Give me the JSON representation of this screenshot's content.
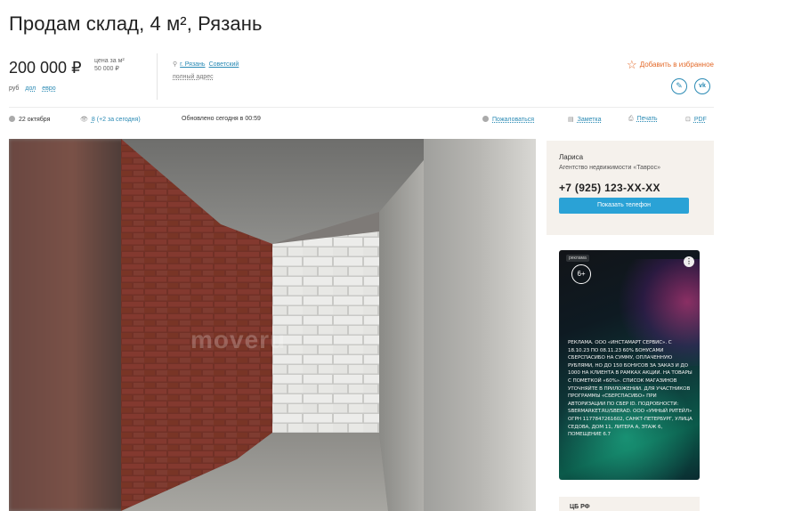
{
  "listing": {
    "title": "Продам склад, 4 м², Рязань",
    "price": "200 000 ₽",
    "price_per_m_label": "цена за м²",
    "price_per_m_value": "50 000 ₽",
    "currency_current": "руб",
    "currency_options": [
      "дол",
      "евро"
    ]
  },
  "address": {
    "city": "г. Рязань",
    "district": "Советский",
    "full_address_link": "полный адрес"
  },
  "actions": {
    "favorite": "Добавить в избранное",
    "share_icons": [
      "link-icon",
      "vk-icon"
    ]
  },
  "meta": {
    "date": "22 октября",
    "views": "8",
    "views_today": "(+2 за сегодня)",
    "updated": "Обновлено сегодня в 00:59",
    "complain": "Пожаловаться",
    "note": "Заметка",
    "print": "Печать",
    "pdf": "PDF"
  },
  "photo": {
    "watermark": "moveru"
  },
  "contact": {
    "name": "Лариса",
    "agency": "Агентство недвижимости «Таврос»",
    "phone": "+7 (925) 123-XX-XX",
    "show_phone_button": "Показать телефон"
  },
  "ad": {
    "tag": "реклама",
    "age_rating": "6+",
    "text": "РЕКЛАМА. ООО «ИНСТАМАРТ СЕРВИС». С 18.10.23 ПО 08.11.23 60% БОНУСАМИ СБЕРСПАСИБО НА СУММУ, ОПЛАЧЕННУЮ РУБЛЯМИ, НО ДО 150 БОНУСОВ ЗА ЗАКАЗ И ДО 1000 НА КЛИЕНТА В РАМКАХ АКЦИИ. НА ТОВАРЫ С ПОМЕТКОЙ «60%». СПИСОК МАГАЗИНОВ УТОЧНЯЙТЕ В ПРИЛОЖЕНИИ. ДЛЯ УЧАСТНИКОВ ПРОГРАММЫ «СБЕРСПАСИБО» ПРИ АВТОРИЗАЦИИ ПО СБЕР ID. ПОДРОБНОСТИ: SBERMARKET.RU/SBERAD. ООО «УМНЫЙ РИТЕЙЛ» ОГРН 1177847261602, САНКТ-ПЕТЕРБУРГ, УЛИЦА СЕДОВА, ДОМ 11, ЛИТЕРА А, ЭТАЖ 6, ПОМЕЩЕНИЕ 6.7"
  },
  "bottom_panel": {
    "label": "ЦБ РФ"
  },
  "colors": {
    "link": "#2a8ab4",
    "favorite": "#e36a2a",
    "button": "#2aa2d6",
    "panel_bg": "#f5f1ec"
  }
}
